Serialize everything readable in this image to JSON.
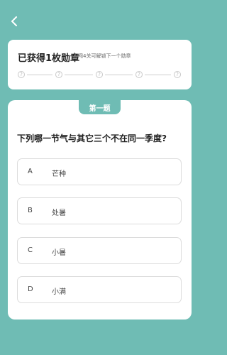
{
  "header": {
    "back_icon": "chevron-left-icon"
  },
  "badge_card": {
    "title": "已获得1枚勋章",
    "subtitle": "再闯4关可解锁下一个勋章",
    "slots": [
      "?",
      "?",
      "?",
      "?",
      "?"
    ]
  },
  "quiz": {
    "tag": "第一题",
    "question": "下列哪一节气与其它三个不在同一季度?",
    "options": [
      {
        "letter": "A",
        "text": "芒种"
      },
      {
        "letter": "B",
        "text": "处暑"
      },
      {
        "letter": "C",
        "text": "小暑"
      },
      {
        "letter": "D",
        "text": "小满"
      }
    ]
  },
  "colors": {
    "background": "#6fbcb4",
    "card": "#ffffff",
    "accent": "#6fbcb4"
  }
}
